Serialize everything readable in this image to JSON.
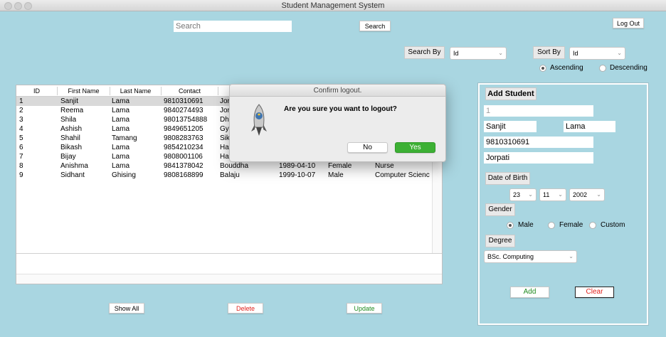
{
  "window": {
    "title": "Student Management System"
  },
  "toolbar": {
    "search_placeholder": "Search",
    "search_button": "Search",
    "logout_button": "Log Out",
    "search_by_label": "Search By",
    "search_by_value": "Id",
    "sort_by_label": "Sort By",
    "sort_by_value": "Id",
    "ascending": "Ascending",
    "descending": "Descending",
    "sort_order": "Ascending"
  },
  "table": {
    "columns": [
      "ID",
      "First Name",
      "Last Name",
      "Contact"
    ],
    "rows": [
      {
        "id": "1",
        "first": "Sanjit",
        "last": "Lama",
        "contact": "9810310691",
        "address": "Jor",
        "dob": "",
        "gender": "",
        "degree": ""
      },
      {
        "id": "2",
        "first": "Reema",
        "last": "Lama",
        "contact": "9840274493",
        "address": "Jor",
        "dob": "",
        "gender": "",
        "degree": ""
      },
      {
        "id": "3",
        "first": "Shila",
        "last": "Lama",
        "contact": "98013754888",
        "address": "Dhu",
        "dob": "",
        "gender": "",
        "degree": ""
      },
      {
        "id": "4",
        "first": "Ashish",
        "last": "Lama",
        "contact": "9849651205",
        "address": "Gya",
        "dob": "",
        "gender": "",
        "degree": ""
      },
      {
        "id": "5",
        "first": "Shahil",
        "last": "Tamang",
        "contact": "9808283763",
        "address": "Sik",
        "dob": "",
        "gender": "",
        "degree": ""
      },
      {
        "id": "6",
        "first": "Bikash",
        "last": "Lama",
        "contact": "9854210234",
        "address": "Har",
        "dob": "",
        "gender": "",
        "degree": ""
      },
      {
        "id": "7",
        "first": "Bijay",
        "last": "Lama",
        "contact": "9808001106",
        "address": "Har",
        "dob": "",
        "gender": "",
        "degree": ""
      },
      {
        "id": "8",
        "first": "Anishma",
        "last": "Lama",
        "contact": "9841378042",
        "address": "Bouddha",
        "dob": "1989-04-10",
        "gender": "Female",
        "degree": "Nurse"
      },
      {
        "id": "9",
        "first": "Sidhant",
        "last": "Ghising",
        "contact": "9808168899",
        "address": "Balaju",
        "dob": "1999-10-07",
        "gender": "Male",
        "degree": "Computer Scienc"
      }
    ]
  },
  "bottom_buttons": {
    "show_all": "Show All",
    "delete": "Delete",
    "update": "Update"
  },
  "dialog": {
    "title": "Confirm logout.",
    "message": "Are you sure you want to logout?",
    "no": "No",
    "yes": "Yes",
    "icon": "python-rocket-icon"
  },
  "form": {
    "heading": "Add Student",
    "id_value": "1",
    "first_name": "Sanjit",
    "last_name": "Lama",
    "contact": "9810310691",
    "address": "Jorpati",
    "dob_label": "Date of Birth",
    "dob_day": "23",
    "dob_month": "11",
    "dob_year": "2002",
    "gender_label": "Gender",
    "gender_options": [
      "Male",
      "Female",
      "Custom"
    ],
    "gender_value": "Male",
    "degree_label": "Degree",
    "degree_value": "BSc. Computing",
    "add_button": "Add",
    "clear_button": "Clear"
  },
  "colors": {
    "background": "#a9d6e1",
    "yes_green": "#3cb034",
    "delete_red": "#e0201b",
    "add_green": "#1f8a1f"
  }
}
